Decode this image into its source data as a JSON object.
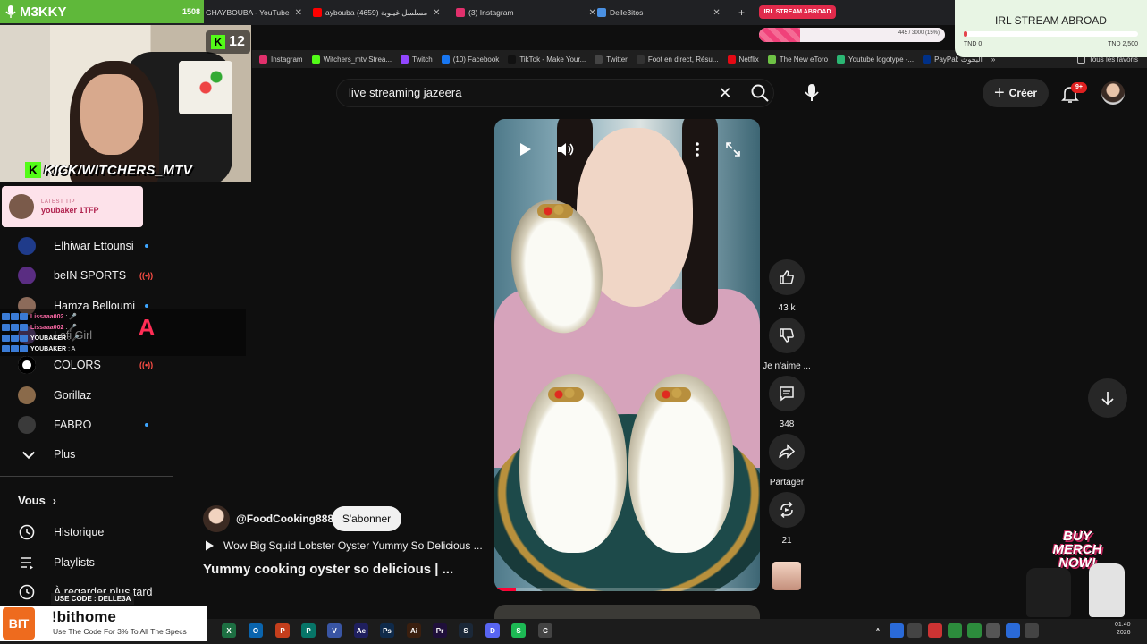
{
  "browser": {
    "tabs": [
      {
        "label": "GHAYBOUBA - YouTube",
        "color": "#ff0000"
      },
      {
        "label": "aybouba مسلسل غيبوبة (4659)",
        "color": "#ff0000"
      },
      {
        "label": "(3) Instagram",
        "color": "#e1306c"
      },
      {
        "label": "Delle3itos",
        "color": "#4a90e2"
      }
    ],
    "new_tab_symbol": "+",
    "active_tab_label": "IRL STREAM ABROAD",
    "bookmarks": [
      {
        "label": "Instagram",
        "color": "#e1306c"
      },
      {
        "label": "Witchers_mtv Strea...",
        "color": "#53fc18"
      },
      {
        "label": "Twitch",
        "color": "#9146ff"
      },
      {
        "label": "(10) Facebook",
        "color": "#1877f2"
      },
      {
        "label": "TikTok - Make Your...",
        "color": "#111111"
      },
      {
        "label": "Twitter",
        "color": "#444444"
      },
      {
        "label": "Foot en direct, Résu...",
        "color": "#333333"
      },
      {
        "label": "Netflix",
        "color": "#e50914"
      },
      {
        "label": "The New eToro",
        "color": "#6ec245"
      },
      {
        "label": "Youtube logotype -...",
        "color": "#2bb673"
      },
      {
        "label": "PayPal: البحوث",
        "color": "#003087"
      }
    ],
    "bookmarks_more": "»",
    "all_bookmarks": "Tous les favoris"
  },
  "overlay": {
    "streamer_name": "M3KKY",
    "viewer_count": "1508",
    "kick_viewers": "12",
    "kick_handle": "KICK/WITCHERS_MTV",
    "latest_tip_label": "LATEST TIP",
    "latest_tip_value": "youbaker 1TFP",
    "goal_title": "IRL STREAM ABROAD",
    "goal_min": "TND 0",
    "goal_max": "TND 2,500",
    "goal_fraction": 0.02,
    "top_progress_text": "445 / 3000 (15%)",
    "top_progress_fraction": 0.22,
    "merch_text": "BUY MERCH NOW!",
    "chat": [
      {
        "user": "Lissaaa002",
        "msg": ": 🎤",
        "color": "#ff6aa8"
      },
      {
        "user": "Lissaaa002",
        "msg": ": 🎤",
        "color": "#ff6aa8"
      },
      {
        "user": "YOUBAKER",
        "msg": ": 🎤",
        "color": "#ffffff"
      },
      {
        "user": "YOUBAKER",
        "msg": ": A",
        "color": "#ffffff"
      }
    ],
    "big_letter": "A",
    "ad": {
      "code_text": "USE CODE : DELLE3A",
      "logo_text": "BIT",
      "brand": "!bithome",
      "tagline": "Use The Code For 3% To All The Specs"
    }
  },
  "youtube": {
    "search_query": "live streaming jazeera",
    "create_label": "Créer",
    "notification_badge": "9+",
    "sidebar_subscriptions": [
      {
        "label": "Elhiwar Ettounsi",
        "indicator": "dot",
        "icon_color": "#1f3b8a"
      },
      {
        "label": "beIN SPORTS",
        "indicator": "live",
        "icon_color": "#5a2d82"
      },
      {
        "label": "Hamza Belloumi",
        "indicator": "dot",
        "icon_color": "#8c6b5a"
      },
      {
        "label": "Lofi Girl",
        "indicator": "none",
        "icon_color": "#6b4f8a"
      },
      {
        "label": "COLORS",
        "indicator": "live",
        "icon_color": "#ffffff"
      },
      {
        "label": "Gorillaz",
        "indicator": "none",
        "icon_color": "#8a6a4a"
      },
      {
        "label": "FABRO",
        "indicator": "dot",
        "icon_color": "#3a3a3a"
      }
    ],
    "more_label": "Plus",
    "live_symbol": "((•))",
    "you_label": "Vous",
    "you_items": [
      {
        "label": "Historique",
        "icon": "history-icon"
      },
      {
        "label": "Playlists",
        "icon": "playlists-icon"
      },
      {
        "label": "À regarder plus tard",
        "icon": "watch-later-icon"
      }
    ],
    "short": {
      "channel": "@FoodCooking888",
      "subscribe_label": "S'abonner",
      "related_title": "Wow Big Squid Lobster Oyster Yummy So Delicious ...",
      "title": "Yummy cooking oyster so delicious | ...",
      "progress_fraction": 0.08,
      "likes": "43 k",
      "dislike_label": "Je n'aime ...",
      "comments": "348",
      "share_label": "Partager",
      "remix_count": "21"
    }
  },
  "taskbar": {
    "clock_time": "01:40",
    "clock_date": "2026"
  }
}
